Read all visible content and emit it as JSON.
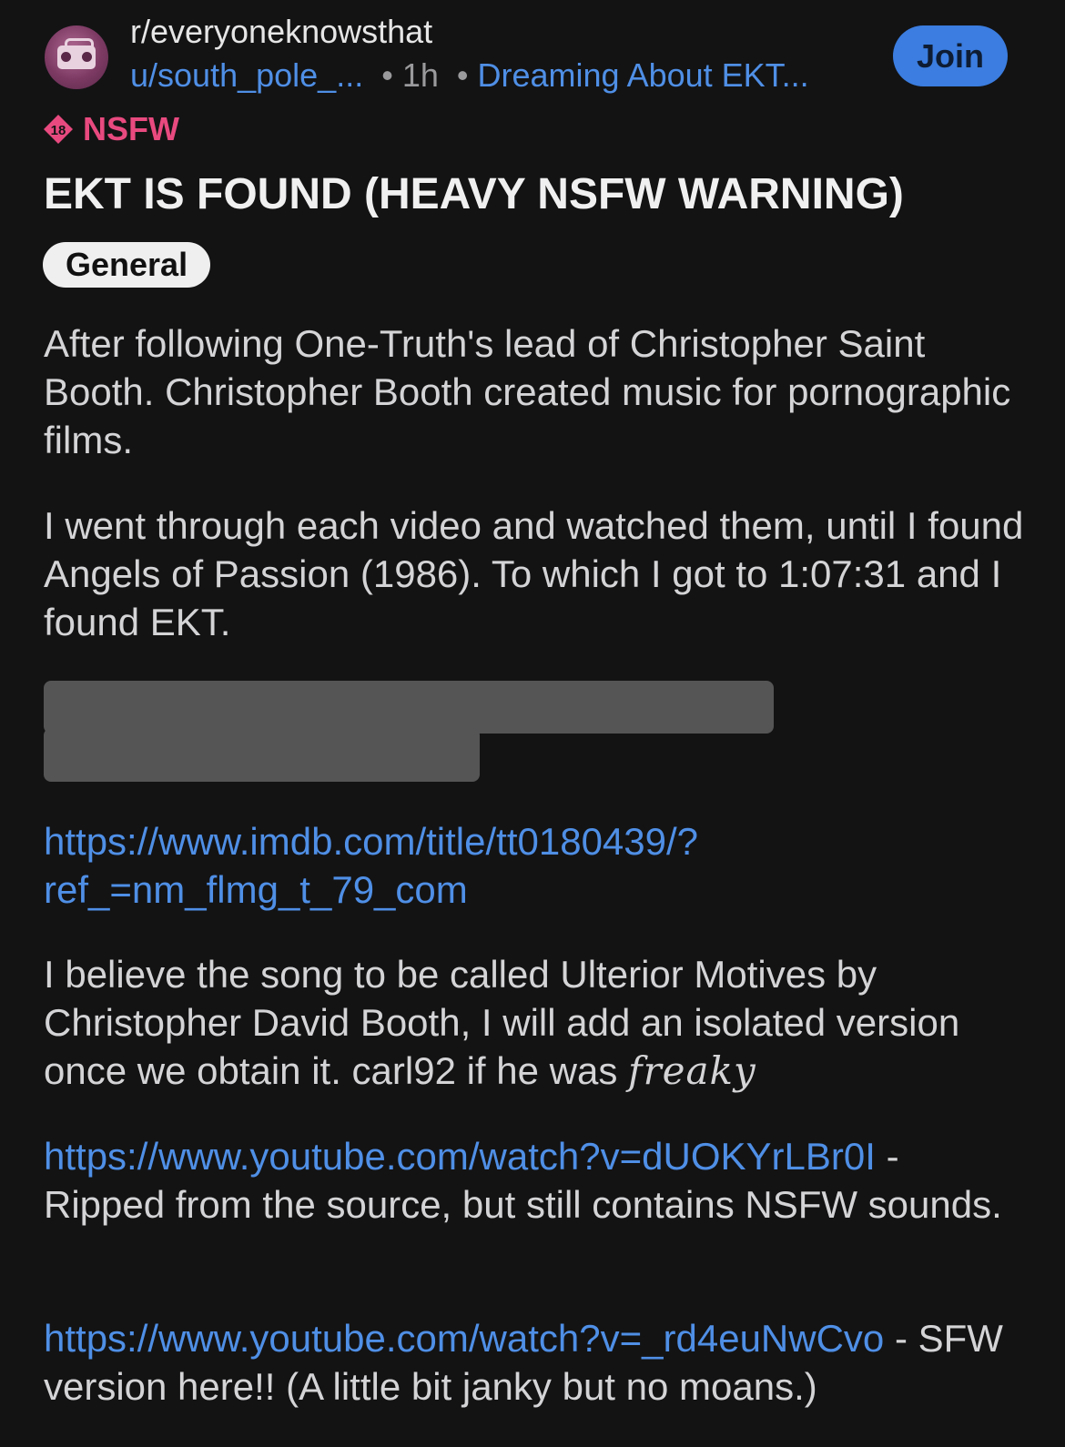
{
  "header": {
    "subreddit": "r/everyoneknowsthat",
    "username": "u/south_pole_...",
    "time": "1h",
    "post_flair_link": "Dreaming About EKT...",
    "join_label": "Join",
    "avatar_icon": "boombox-icon"
  },
  "nsfw": {
    "badge_number": "18",
    "label": "NSFW",
    "color": "#e84a7f"
  },
  "post": {
    "title": "EKT IS FOUND (HEAVY NSFW WARNING)",
    "flair": "General",
    "paragraph1": "After following One-Truth's lead of Christopher Saint Booth. Christopher Booth created music for pornographic films.",
    "paragraph2": "I went through each video and watched them, until I found Angels of Passion (1986). To which I got to 1:07:31 and I found EKT.",
    "imdb_link_line1": "https://www.imdb.com/title/tt0180439/?",
    "imdb_link_line2": "ref_=nm_flmg_t_79_com",
    "paragraph4": "I believe the song to be called Ulterior Motives by Christopher David Booth, I will add an isolated version once we obtain it.  carl92 if he was ",
    "paragraph4_styled": "freaky",
    "youtube_link1": "https://www.youtube.com/watch?v=dUOKYrLBr0I",
    "youtube_link1_desc": " - Ripped from the source, but still contains NSFW sounds.",
    "youtube_link2": "https://www.youtube.com/watch?v=_rd4euNwCvo",
    "youtube_link2_desc": " - SFW version here!! (A little bit janky but no moans.)"
  },
  "colors": {
    "background": "#131314",
    "link": "#4f8fe6",
    "join_button": "#3b7de0",
    "spoiler_block": "#555556"
  }
}
